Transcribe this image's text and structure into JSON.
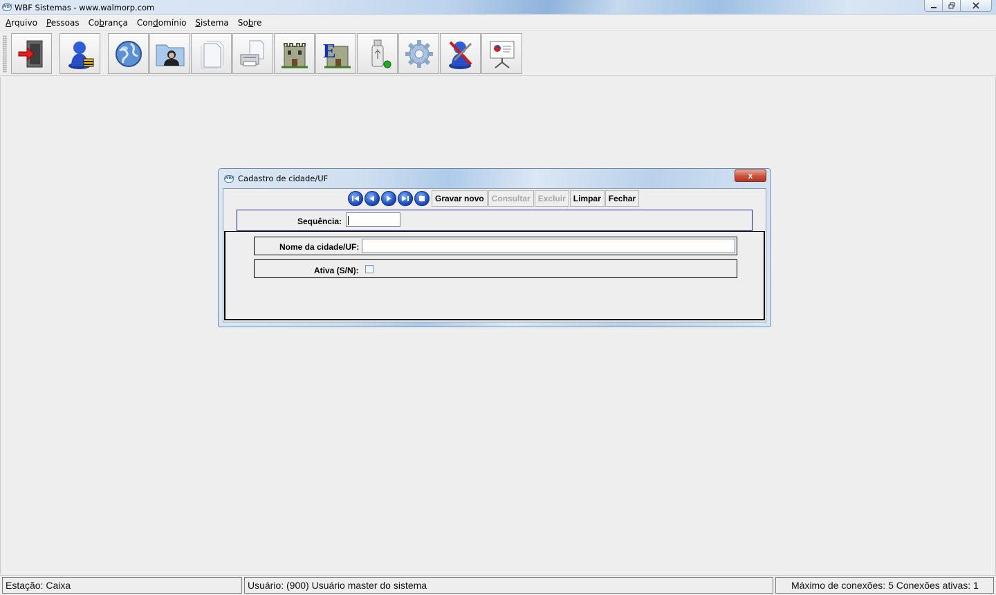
{
  "window": {
    "title": "WBF Sistemas - www.walmorp.com",
    "icon": "wbf-app-icon"
  },
  "menu": [
    {
      "label": "Arquivo",
      "mnemonic": "A"
    },
    {
      "label": "Pessoas",
      "mnemonic": "P"
    },
    {
      "label": "Cobrança",
      "mnemonic": "b"
    },
    {
      "label": "Condomínio",
      "mnemonic": "d"
    },
    {
      "label": "Sistema",
      "mnemonic": "S"
    },
    {
      "label": "Sobre",
      "mnemonic": "b"
    }
  ],
  "toolbar": {
    "buttons": [
      {
        "icon": "exit-door-icon"
      },
      {
        "icon": "user-lock-icon"
      },
      {
        "icon": "globe-icon"
      },
      {
        "icon": "contact-folder-icon"
      },
      {
        "icon": "documents-icon"
      },
      {
        "icon": "printer-icon"
      },
      {
        "icon": "building-icon"
      },
      {
        "icon": "building-e-icon"
      },
      {
        "icon": "usb-drive-icon"
      },
      {
        "icon": "settings-gear-icon"
      },
      {
        "icon": "user-tools-icon"
      },
      {
        "icon": "presentation-board-icon"
      }
    ]
  },
  "dialog": {
    "title": "Cadastro de cidade/UF",
    "close_label": "x",
    "nav": [
      {
        "icon": "first-record-icon"
      },
      {
        "icon": "previous-record-icon"
      },
      {
        "icon": "next-record-icon"
      },
      {
        "icon": "last-record-icon"
      },
      {
        "icon": "stop-icon"
      }
    ],
    "actions": {
      "save_new": "Gravar novo",
      "query": "Consultar",
      "delete": "Excluir",
      "clear": "Limpar",
      "close": "Fechar"
    },
    "disabled_actions": [
      "Consultar",
      "Excluir"
    ],
    "fields": {
      "sequence_label": "Sequência:",
      "sequence_value": "",
      "city_label": "Nome da cidade/UF:",
      "city_value": "",
      "active_label": "Ativa (S/N):",
      "active_checked": false
    }
  },
  "status": {
    "station": "Estação: Caixa",
    "user": "Usuário: (900) Usuário master do sistema",
    "connections": "Máximo de conexões: 5 Conexões ativas: 1"
  },
  "colors": {
    "desktop": "#eeeeee",
    "nav_blue": "#1f4fc2",
    "close_red": "#c9503a",
    "panel_border": "#1c1c8c"
  }
}
